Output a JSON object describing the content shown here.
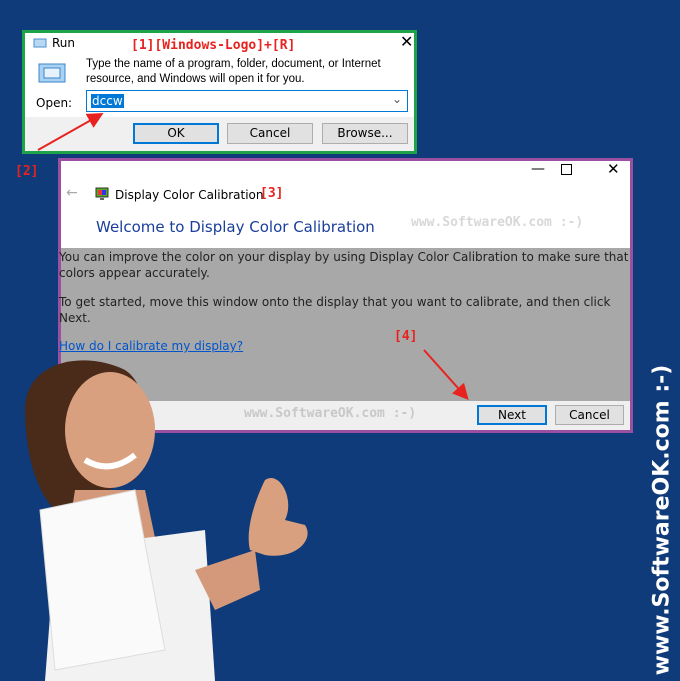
{
  "run_dialog": {
    "title": "Run",
    "annotation": "[1][Windows-Logo]+[R]",
    "description_line1": "Type the name of a program, folder, document, or Internet",
    "description_line2": "resource, and Windows will open it for you.",
    "open_label": "Open:",
    "open_value": "dccw",
    "ok_label": "OK",
    "cancel_label": "Cancel",
    "browse_label": "Browse..."
  },
  "annotation_2": "[2]",
  "calibration": {
    "title": "Display Color Calibration",
    "annotation": "[3]",
    "heading": "Welcome to Display Color Calibration",
    "watermark": "www.SoftwareOK.com :-)",
    "para1_line1": "You can improve the color on your display by using Display Color Calibration to make sure that",
    "para1_line2": "colors appear accurately.",
    "para2_line1": "To get started, move this window onto the display that you want to calibrate, and then click",
    "para2_line2": "Next.",
    "help_link": "How do I calibrate my display?",
    "annotation_4": "[4]",
    "footer_watermark": "www.SoftwareOK.com :-)",
    "next_label": "Next",
    "cancel_label": "Cancel"
  },
  "side_watermark": "www.SoftwareOK.com :-)",
  "colors": {
    "background": "#0f3b7a",
    "run_border": "#1fa348",
    "cal_border": "#9a4fa0",
    "annotation": "#e8231f",
    "link": "#0066cc"
  }
}
